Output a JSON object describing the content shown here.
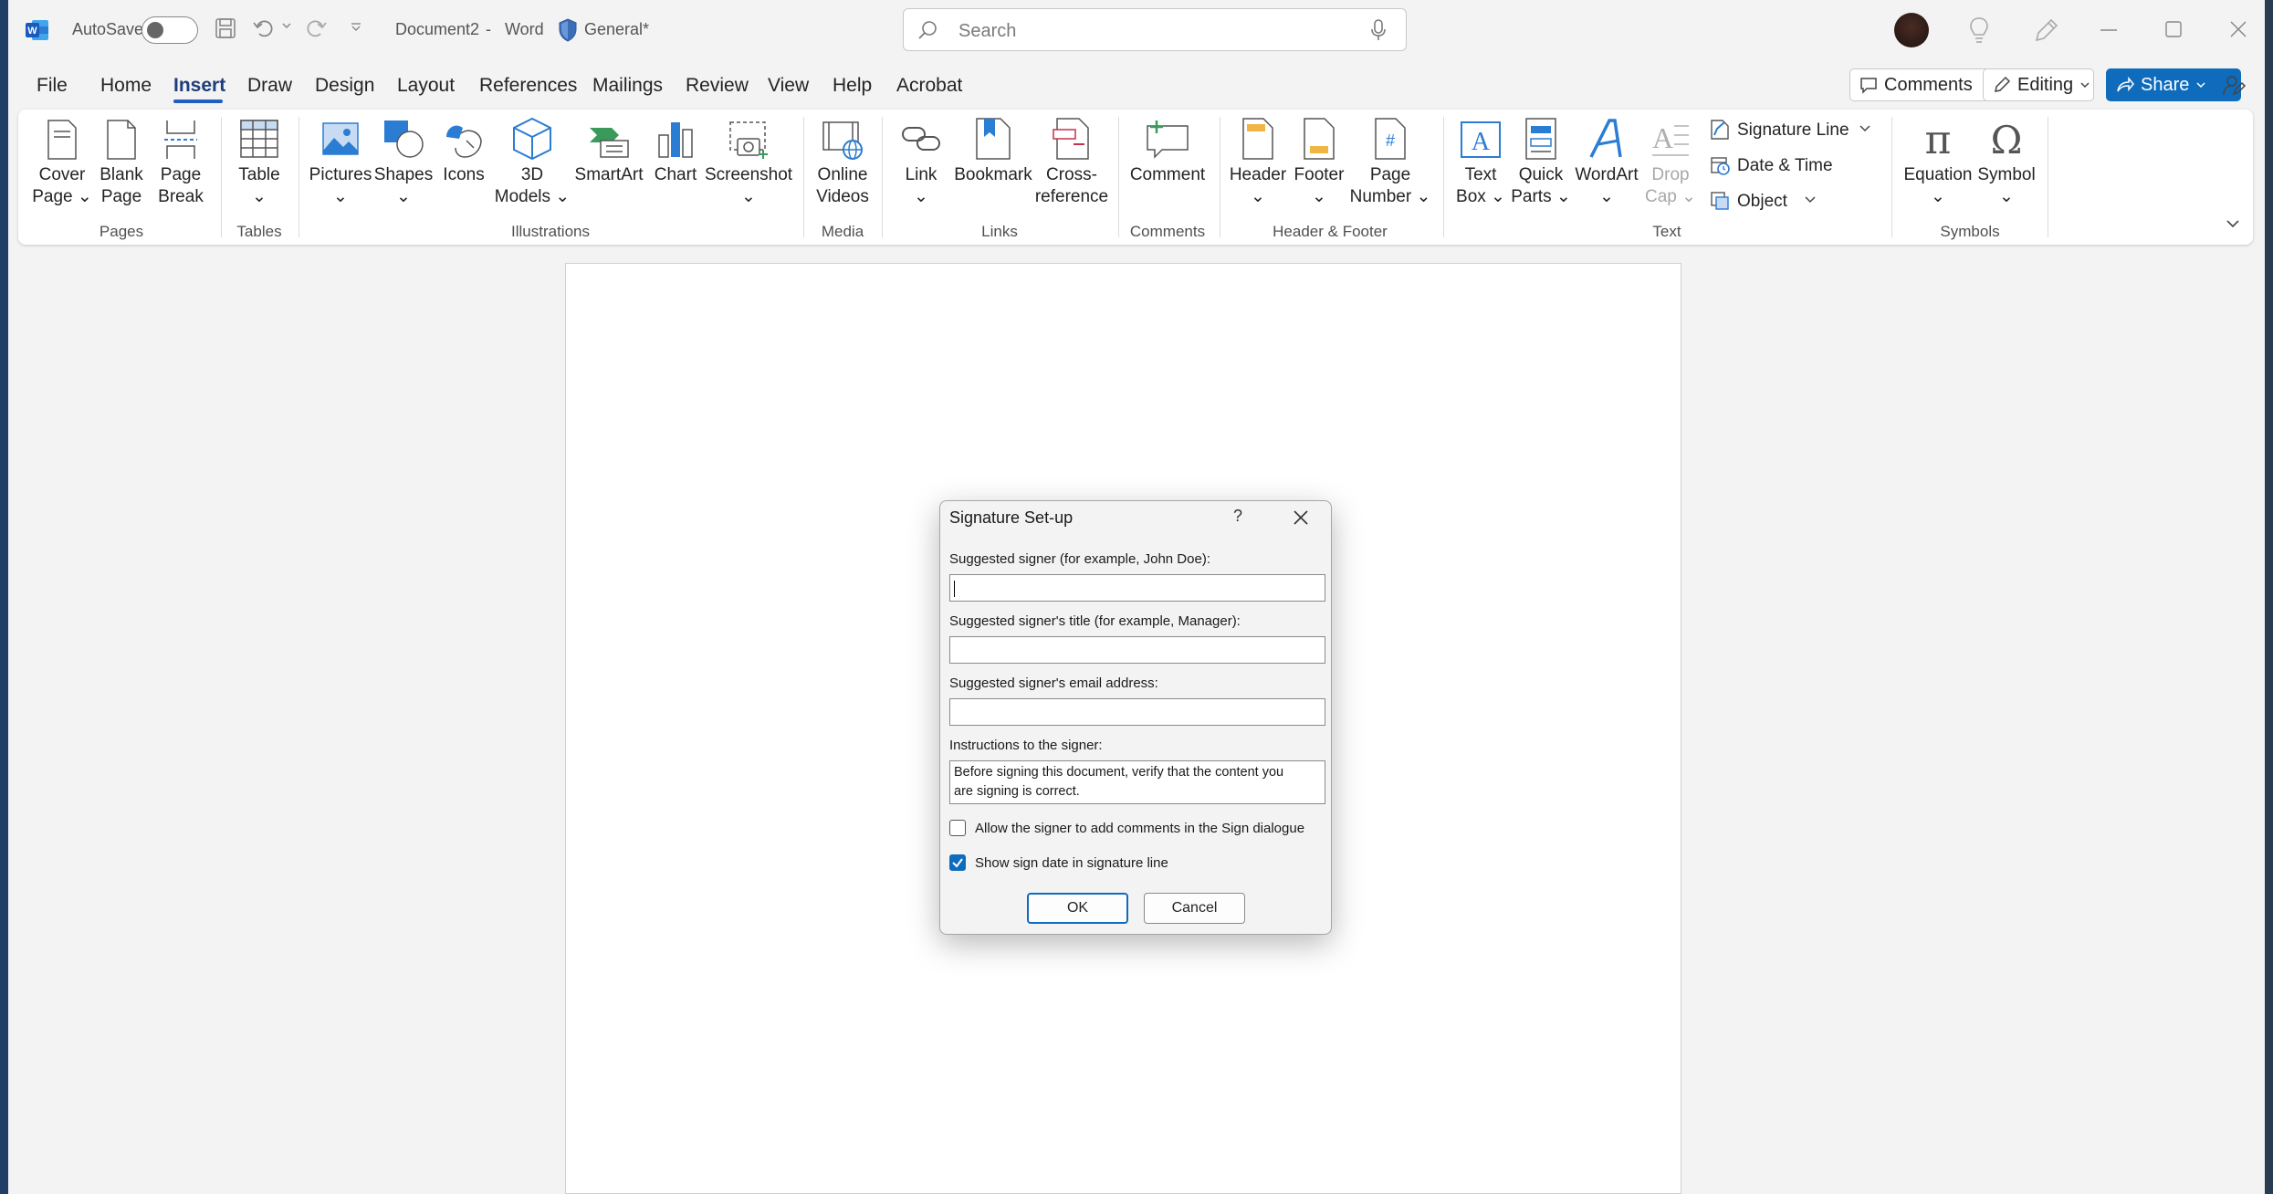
{
  "titlebar": {
    "autosave_label": "AutoSave",
    "autosave_state": "off",
    "document_name": "Document2",
    "separator": "-",
    "app_name": "Word",
    "sensitivity_label": "General*",
    "search_placeholder": "Search"
  },
  "menu_tabs": [
    "File",
    "Home",
    "Insert",
    "Draw",
    "Design",
    "Layout",
    "References",
    "Mailings",
    "Review",
    "View",
    "Help",
    "Acrobat"
  ],
  "active_tab": "Insert",
  "top_right": {
    "comments_label": "Comments",
    "editing_label": "Editing",
    "share_label": "Share"
  },
  "ribbon": {
    "pages": {
      "cover_page": [
        "Cover",
        "Page"
      ],
      "blank_page": [
        "Blank",
        "Page"
      ],
      "page_break": [
        "Page",
        "Break"
      ],
      "group": "Pages"
    },
    "tables": {
      "table": "Table",
      "group": "Tables"
    },
    "illustrations": {
      "pictures": "Pictures",
      "shapes": "Shapes",
      "icons": "Icons",
      "models_3d": [
        "3D",
        "Models"
      ],
      "smartart": "SmartArt",
      "chart": "Chart",
      "screenshot": "Screenshot",
      "group": "Illustrations"
    },
    "media": {
      "online_videos": [
        "Online",
        "Videos"
      ],
      "group": "Media"
    },
    "links": {
      "link": "Link",
      "bookmark": "Bookmark",
      "cross_reference": [
        "Cross-",
        "reference"
      ],
      "group": "Links"
    },
    "comments": {
      "comment": "Comment",
      "group": "Comments"
    },
    "header_footer": {
      "header": "Header",
      "footer": "Footer",
      "page_number": [
        "Page",
        "Number"
      ],
      "group": "Header & Footer"
    },
    "text": {
      "text_box": [
        "Text",
        "Box"
      ],
      "quick_parts": [
        "Quick",
        "Parts"
      ],
      "wordart": "WordArt",
      "drop_cap": [
        "Drop",
        "Cap"
      ],
      "signature_line": "Signature Line",
      "date_time": "Date & Time",
      "object": "Object",
      "group": "Text"
    },
    "symbols": {
      "equation": "Equation",
      "symbol": "Symbol",
      "group": "Symbols"
    }
  },
  "dialog": {
    "title": "Signature Set-up",
    "help": "?",
    "signer_label": "Suggested signer (for example, John Doe):",
    "signer_value": "",
    "title_label": "Suggested signer's title (for example, Manager):",
    "title_value": "",
    "email_label": "Suggested signer's email address:",
    "email_value": "",
    "instructions_label": "Instructions to the signer:",
    "instructions_line1": "Before signing this document, verify that the content you",
    "instructions_line2": "are signing is correct.",
    "allow_comments_label": "Allow the signer to add comments in the Sign dialogue",
    "allow_comments_checked": false,
    "show_date_label": "Show sign date in signature line",
    "show_date_checked": true,
    "ok_label": "OK",
    "cancel_label": "Cancel"
  },
  "colors": {
    "accent": "#0f6cbd",
    "word_blue": "#185abd",
    "active_tab_text": "#1f3d7a",
    "icon_blue": "#2b7cd3",
    "icon_red": "#c4314b",
    "icon_green": "#3a9a5b"
  }
}
